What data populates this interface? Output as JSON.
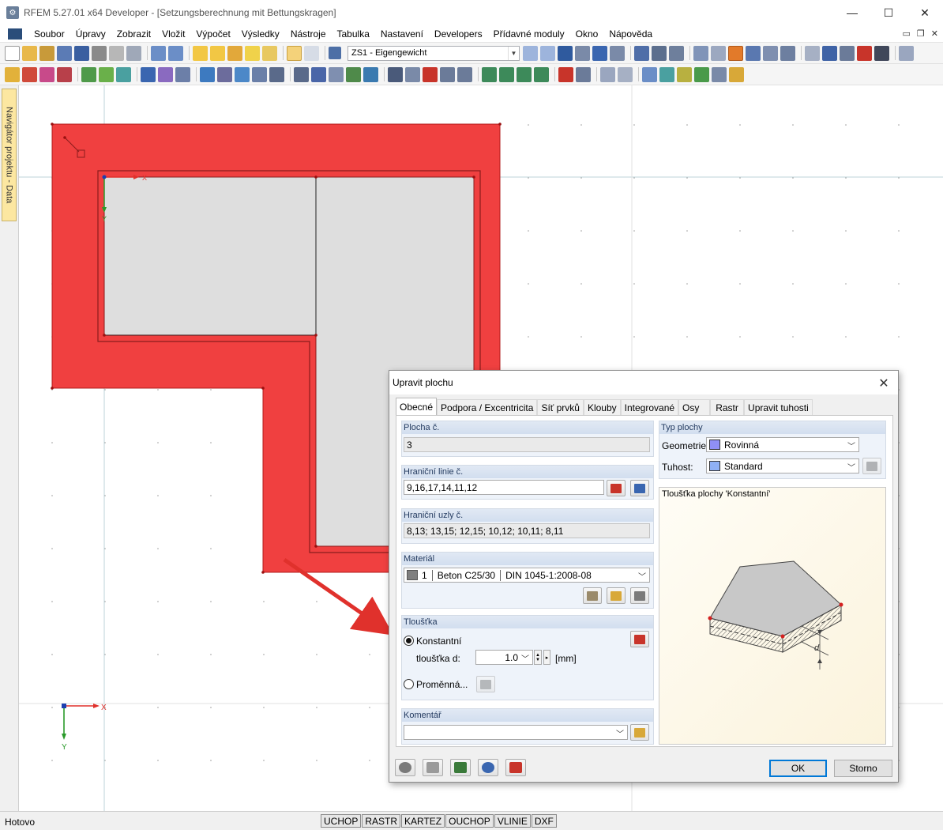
{
  "window": {
    "title": "RFEM 5.27.01 x64 Developer - [Setzungsberechnung mit Bettungskragen]",
    "controls": [
      "—",
      "☐",
      "✕"
    ]
  },
  "menu": {
    "items": [
      "Soubor",
      "Úpravy",
      "Zobrazit",
      "Vložit",
      "Výpočet",
      "Výsledky",
      "Nástroje",
      "Tabulka",
      "Nastavení",
      "Developers",
      "Přídavné moduly",
      "Okno",
      "Nápověda"
    ],
    "mdi_controls": [
      "▭",
      "❐",
      "✕"
    ]
  },
  "toolbar": {
    "load_case": "ZS1 - Eigengewicht"
  },
  "navigator": {
    "tab_label": "Navigátor projektu - Data"
  },
  "canvas": {
    "axes_main": {
      "x": "X",
      "y": "Y"
    },
    "axes_local": {
      "x": "X",
      "y": "Y"
    },
    "colors": {
      "surface": "#f04040",
      "inner_surface": "#dedede",
      "grid_line": "#bcd3d8"
    }
  },
  "statusbar": {
    "status": "Hotovo",
    "modes": [
      "UCHOP",
      "RASTR",
      "KARTEZ",
      "OUCHOP",
      "VLINIE",
      "DXF"
    ]
  },
  "dialog": {
    "title": "Upravit plochu",
    "tabs": [
      "Obecné",
      "Podpora / Excentricita",
      "Síť prvků",
      "Klouby",
      "Integrované",
      "Osy",
      "Rastr",
      "Upravit tuhosti"
    ],
    "active_tab": "Obecné",
    "surface_no": {
      "label": "Plocha č.",
      "value": "3"
    },
    "boundary_lines": {
      "label": "Hraniční linie č.",
      "value": "9,16,17,14,11,12"
    },
    "boundary_nodes": {
      "label": "Hraniční uzly č.",
      "value": "8,13; 13,15; 12,15; 10,12; 10,11; 8,11"
    },
    "material": {
      "label": "Materiál",
      "number": "1",
      "name": "Beton C25/30",
      "norm": "DIN 1045-1:2008-08",
      "color": "#7f7f7f"
    },
    "thickness": {
      "label": "Tloušťka",
      "constant_label": "Konstantní",
      "constant_selected": true,
      "d_label": "tloušťka d:",
      "d_value": "1.0",
      "unit": "[mm]",
      "variable_label": "Proměnná..."
    },
    "comment": {
      "label": "Komentář",
      "value": ""
    },
    "surface_type": {
      "label": "Typ plochy",
      "geometry_label": "Geometrie:",
      "geometry_value": "Rovinná",
      "stiffness_label": "Tuhost:",
      "stiffness_value": "Standard",
      "swatch_color": "#8f8ff5"
    },
    "preview": {
      "title": "Tloušťka plochy 'Konstantní'",
      "dim_label": "d"
    },
    "buttons": {
      "ok": "OK",
      "cancel": "Storno"
    }
  }
}
